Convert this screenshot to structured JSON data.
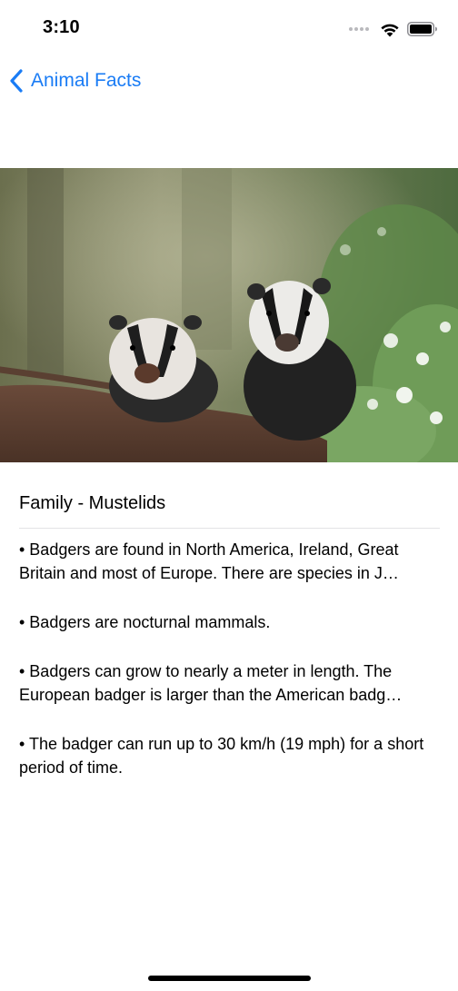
{
  "status_bar": {
    "time": "3:10"
  },
  "nav": {
    "back_label": "Animal Facts",
    "accent_color": "#1a7cf5"
  },
  "hero_image": {
    "subject": "two badgers in a woodland"
  },
  "content": {
    "family_title": "Family - Mustelids",
    "facts": [
      "• Badgers are found in North America, Ireland, Great Britain and most of Europe. There are species in J…",
      "• Badgers are nocturnal mammals.",
      "• Badgers can grow to nearly a meter in length. The European badger is larger than the American badg…",
      "• The badger can run up to 30 km/h (19 mph) for a short period of time."
    ]
  }
}
